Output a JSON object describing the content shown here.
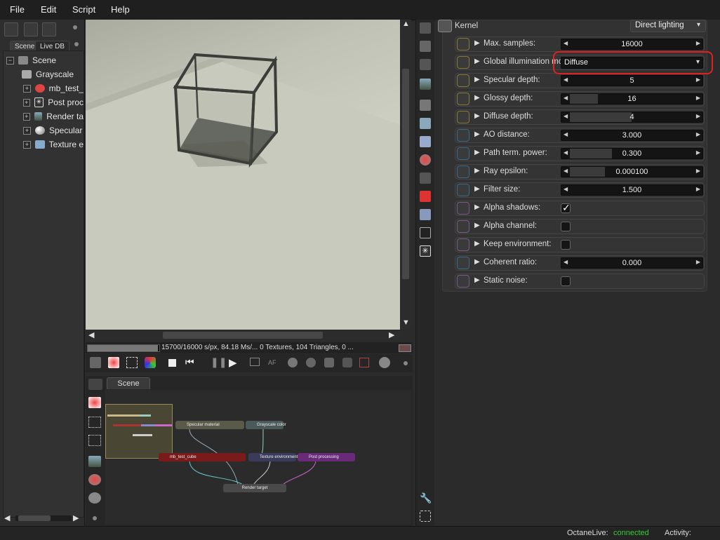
{
  "menu": [
    "File",
    "Edit",
    "Script",
    "Help"
  ],
  "left_panel": {
    "tabs": [
      "Scene",
      "Live DB"
    ],
    "tree": [
      {
        "label": "Scene",
        "expand": "−",
        "icon": "scene-icon"
      },
      {
        "label": "Grayscale",
        "expand": "",
        "icon": "grayscale-icon"
      },
      {
        "label": "mb_test_",
        "expand": "+",
        "icon": "material-icon"
      },
      {
        "label": "Post proc",
        "expand": "+",
        "icon": "post-processing-icon"
      },
      {
        "label": "Render ta",
        "expand": "+",
        "icon": "render-target-icon"
      },
      {
        "label": "Specular",
        "expand": "+",
        "icon": "specular-material-icon"
      },
      {
        "label": "Texture e",
        "expand": "+",
        "icon": "texture-environment-icon"
      }
    ]
  },
  "viewport": {
    "status_text": "15700/16000 s/px, 84.18 Ms/... 0 Textures, 104 Triangles, 0 ...",
    "render_progress_fraction": 0.98
  },
  "render_toolbar": {
    "buttons": [
      "cloud-render-icon",
      "reset-render-icon",
      "fit-view-icon",
      "color-cube-icon",
      "stop-icon",
      "restart-icon",
      "pause-icon",
      "play-icon",
      "region-render-icon",
      "autofocus-icon",
      "material-picker-icon",
      "object-picker-icon",
      "camera-picker-icon",
      "white-balance-icon",
      "focus-picker-icon",
      "settings-icon"
    ],
    "af_label": "AF"
  },
  "node_graph": {
    "tab": "Scene",
    "nodes": [
      {
        "label": "Specular material",
        "color": "#5a5a4a"
      },
      {
        "label": "Grayscale color",
        "color": "#4a5a5a"
      },
      {
        "label": "mb_test_cube",
        "color": "#7a1a1a"
      },
      {
        "label": "Texture environment",
        "color": "#3a3a5a"
      },
      {
        "label": "Post processing",
        "color": "#6a2a7a"
      },
      {
        "label": "Render target",
        "color": "#4a4a4a"
      }
    ]
  },
  "inspector": {
    "kernel_label": "Kernel",
    "kernel_type": "Direct lighting",
    "params": [
      {
        "label": "Max. samples:",
        "type": "slider",
        "value": "16000",
        "fill": 0.0,
        "icon": "int-param-icon"
      },
      {
        "label": "Global illumination mode:",
        "type": "dropdown",
        "value": "Diffuse",
        "icon": "enum-param-icon",
        "highlighted": true
      },
      {
        "label": "Specular depth:",
        "type": "slider",
        "value": "5",
        "fill": 0.0,
        "icon": "int-param-icon"
      },
      {
        "label": "Glossy depth:",
        "type": "slider",
        "value": "16",
        "fill": 0.2,
        "icon": "int-param-icon"
      },
      {
        "label": "Diffuse depth:",
        "type": "slider",
        "value": "4",
        "fill": 0.44,
        "icon": "int-param-icon"
      },
      {
        "label": "AO distance:",
        "type": "slider",
        "value": "3.000",
        "fill": 0.0,
        "icon": "float-param-icon"
      },
      {
        "label": "Path term. power:",
        "type": "slider",
        "value": "0.300",
        "fill": 0.3,
        "icon": "float-param-icon"
      },
      {
        "label": "Ray epsilon:",
        "type": "slider",
        "value": "0.000100",
        "fill": 0.25,
        "icon": "float-param-icon"
      },
      {
        "label": "Filter size:",
        "type": "slider",
        "value": "1.500",
        "fill": 0.0,
        "icon": "float-param-icon"
      },
      {
        "label": "Alpha shadows:",
        "type": "checkbox",
        "checked": true,
        "mark": "✓",
        "icon": "bool-param-icon"
      },
      {
        "label": "Alpha channel:",
        "type": "checkbox",
        "checked": false,
        "mark": "",
        "icon": "bool-param-icon"
      },
      {
        "label": "Keep environment:",
        "type": "checkbox",
        "checked": false,
        "mark": "",
        "icon": "bool-param-icon"
      },
      {
        "label": "Coherent ratio:",
        "type": "slider",
        "value": "0.000",
        "fill": 0.0,
        "icon": "float-param-icon"
      },
      {
        "label": "Static noise:",
        "type": "checkbox",
        "checked": false,
        "mark": "",
        "icon": "bool-param-icon"
      }
    ]
  },
  "status_bar": {
    "service_label": "OctaneLive:",
    "service_status": "connected",
    "activity_label": "Activity:"
  },
  "colors": {
    "connected": "#33cc33",
    "highlight_ring": "#dd2222"
  }
}
